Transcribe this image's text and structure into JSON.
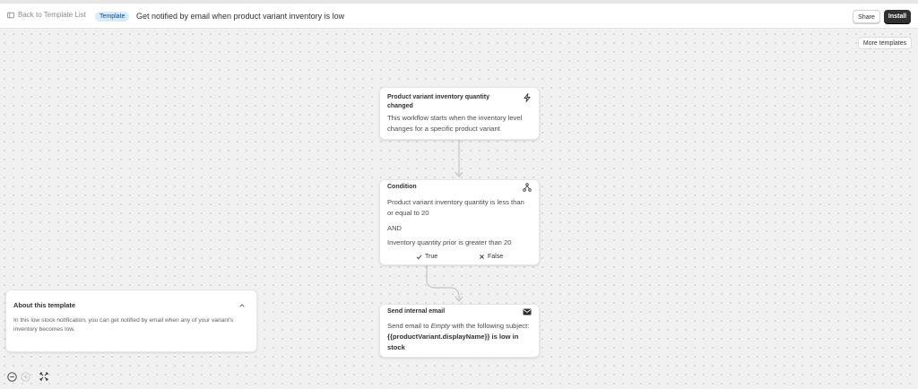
{
  "header": {
    "back_label": "Back to Template List",
    "badge": "Template",
    "title": "Get notified by email when product variant inventory is low",
    "share_label": "Share",
    "install_label": "Install"
  },
  "canvas": {
    "more_templates_label": "More templates",
    "nodes": {
      "trigger": {
        "title": "Product variant inventory quantity changed",
        "icon": "lightning-icon",
        "body": "This workflow starts when the inventory level changes for a specific product variant"
      },
      "condition": {
        "title": "Condition",
        "icon": "branch-icon",
        "rule1": "Product variant inventory quantity is less than or equal to 20",
        "operator": "AND",
        "rule2": "Inventory quantity prior is greater than 20",
        "true_label": "True",
        "false_label": "False"
      },
      "action": {
        "title": "Send internal email",
        "icon": "mail-icon",
        "body_prefix": "Send email to",
        "body_empty": "Empty",
        "body_middle": "with the following subject:",
        "body_subject": "{{productVariant.displayName}} is low in stock"
      }
    }
  },
  "about": {
    "title": "About this template",
    "body": "In this low stock notification, you can get notified by email when any of your variant's inventory becomes low."
  },
  "colors": {
    "accent_badge_bg": "#d5ebff",
    "install_bg": "#303030",
    "canvas_bg": "#f1f1f1"
  }
}
